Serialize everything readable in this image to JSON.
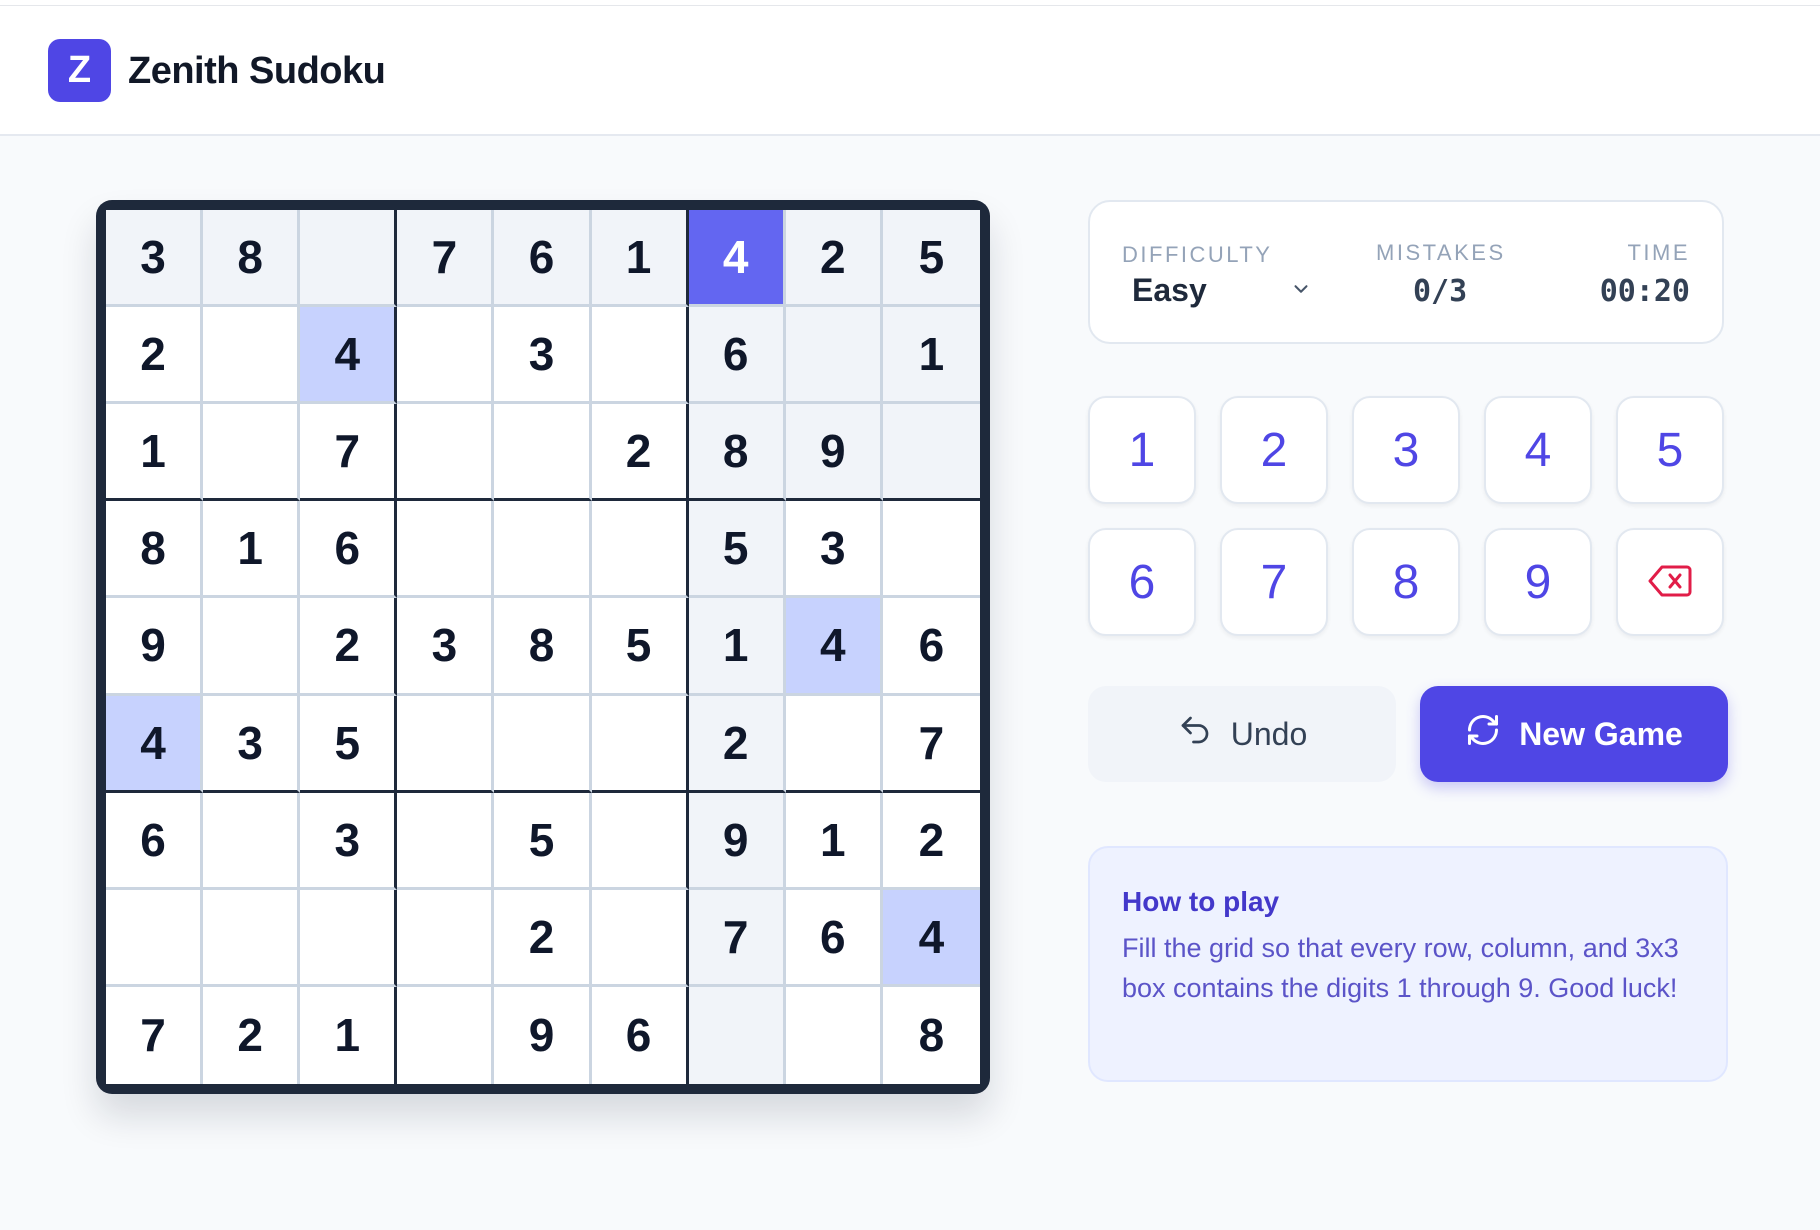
{
  "app": {
    "logo_letter": "Z",
    "title": "Zenith Sudoku"
  },
  "board": {
    "cells": [
      [
        3,
        8,
        null,
        7,
        6,
        1,
        4,
        2,
        5
      ],
      [
        2,
        null,
        4,
        null,
        3,
        null,
        6,
        null,
        1
      ],
      [
        1,
        null,
        7,
        null,
        null,
        2,
        8,
        9,
        null
      ],
      [
        8,
        1,
        6,
        null,
        null,
        null,
        5,
        3,
        null
      ],
      [
        9,
        null,
        2,
        3,
        8,
        5,
        1,
        4,
        6
      ],
      [
        4,
        3,
        5,
        null,
        null,
        null,
        2,
        null,
        7
      ],
      [
        6,
        null,
        3,
        null,
        5,
        null,
        9,
        1,
        2
      ],
      [
        null,
        null,
        null,
        null,
        2,
        null,
        7,
        6,
        4
      ],
      [
        7,
        2,
        1,
        null,
        9,
        6,
        null,
        null,
        8
      ]
    ],
    "selected": {
      "row": 1,
      "col": 7
    }
  },
  "status": {
    "difficulty_label": "DIFFICULTY",
    "difficulty_value": "Easy",
    "mistakes_label": "MISTAKES",
    "mistakes_value": "0/3",
    "time_label": "TIME",
    "time_value": "00:20"
  },
  "keypad": {
    "digits": [
      "1",
      "2",
      "3",
      "4",
      "5",
      "6",
      "7",
      "8",
      "9"
    ],
    "erase_icon": "backspace-icon"
  },
  "actions": {
    "undo_label": "Undo",
    "undo_icon": "undo-icon",
    "new_game_label": "New Game",
    "new_game_icon": "refresh-icon"
  },
  "help": {
    "title": "How to play",
    "text": "Fill the grid so that every row, column, and 3x3 box contains the digits 1 through 9. Good luck!"
  },
  "colors": {
    "accent": "#4f46e5",
    "selected_cell": "#6366f1",
    "same_digit": "#c7d2fe",
    "peer_cell": "#f1f4f9",
    "erase": "#e11d48"
  }
}
